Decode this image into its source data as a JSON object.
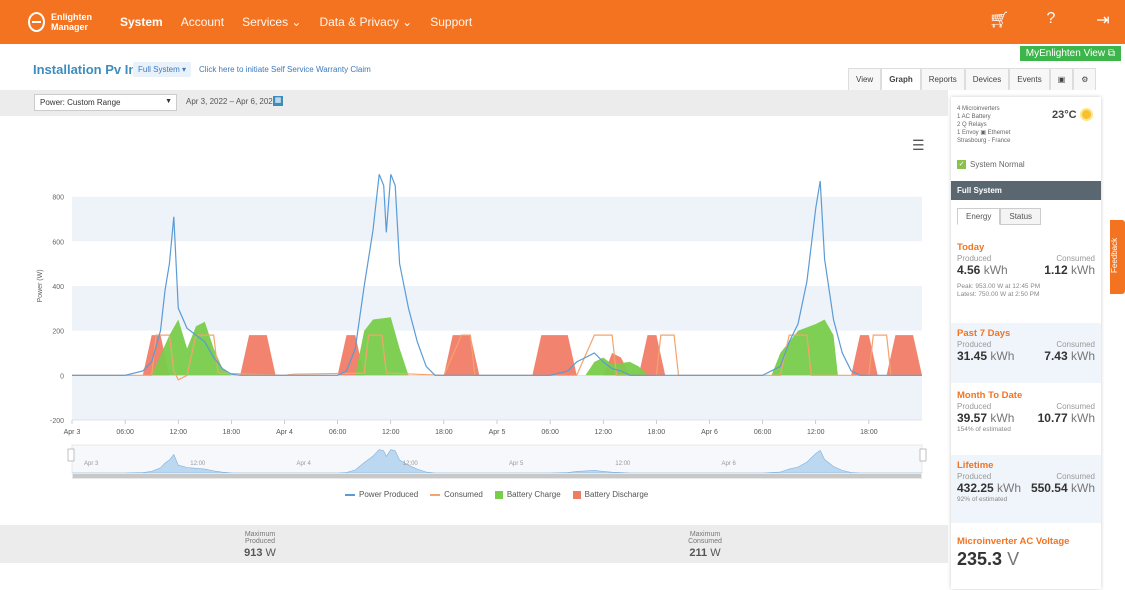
{
  "app": {
    "logo_line1": "Enlighten",
    "logo_line2": "Manager"
  },
  "nav": [
    "System",
    "Account",
    "Services ⌄",
    "Data & Privacy ⌄",
    "Support"
  ],
  "top_icons": [
    "cart-icon",
    "help-icon",
    "logout-icon"
  ],
  "myenlighten": "MyEnlighten View ⧉",
  "header": {
    "title": "Installation Pv Insa",
    "scope": "Full System ▾",
    "warranty_link": "Click here to initiate Self Service Warranty Claim"
  },
  "tabs": [
    "View",
    "Graph",
    "Reports",
    "Devices",
    "Events",
    "▣",
    "⚙"
  ],
  "controls": {
    "select_value": "Power: Custom Range",
    "date_range": "Apr 3, 2022 – Apr 6, 2022"
  },
  "chart_data": {
    "type": "line",
    "ylabel": "Power (W)",
    "ylim": [
      -200,
      1000
    ],
    "yticks": [
      -200,
      0,
      200,
      400,
      600,
      800
    ],
    "xticks": [
      "Apr 3",
      "06:00",
      "12:00",
      "18:00",
      "Apr 4",
      "06:00",
      "12:00",
      "18:00",
      "Apr 5",
      "06:00",
      "12:00",
      "18:00",
      "Apr 6",
      "06:00",
      "12:00",
      "18:00"
    ],
    "navigator_labels": [
      "Apr 3",
      "12:00",
      "Apr 4",
      "12:00",
      "Apr 5",
      "12:00",
      "Apr 6"
    ],
    "x_hours_start": 0,
    "series": [
      {
        "name": "Power Produced",
        "color": "#5b9bd5",
        "points": [
          [
            0,
            0
          ],
          [
            6,
            0
          ],
          [
            8,
            20
          ],
          [
            9,
            60
          ],
          [
            10,
            200
          ],
          [
            10.5,
            380
          ],
          [
            11,
            500
          ],
          [
            11.5,
            710
          ],
          [
            12,
            300
          ],
          [
            13,
            210
          ],
          [
            14,
            180
          ],
          [
            15,
            150
          ],
          [
            16,
            80
          ],
          [
            17,
            30
          ],
          [
            18,
            5
          ],
          [
            19,
            0
          ],
          [
            30,
            0
          ],
          [
            31,
            20
          ],
          [
            32,
            120
          ],
          [
            33,
            400
          ],
          [
            34,
            650
          ],
          [
            34.7,
            900
          ],
          [
            35.2,
            850
          ],
          [
            35.5,
            640
          ],
          [
            36,
            900
          ],
          [
            36.5,
            850
          ],
          [
            37,
            500
          ],
          [
            38,
            300
          ],
          [
            39,
            150
          ],
          [
            40,
            40
          ],
          [
            41,
            0
          ],
          [
            54,
            0
          ],
          [
            56,
            20
          ],
          [
            57,
            60
          ],
          [
            58,
            80
          ],
          [
            59,
            100
          ],
          [
            60,
            60
          ],
          [
            61,
            30
          ],
          [
            62,
            20
          ],
          [
            63,
            0
          ],
          [
            78,
            0
          ],
          [
            80,
            40
          ],
          [
            81,
            150
          ],
          [
            82,
            230
          ],
          [
            83,
            420
          ],
          [
            84,
            750
          ],
          [
            84.5,
            870
          ],
          [
            85,
            520
          ],
          [
            86,
            250
          ],
          [
            87,
            100
          ],
          [
            88,
            20
          ],
          [
            89,
            0
          ],
          [
            96,
            0
          ]
        ]
      },
      {
        "name": "Consumed",
        "color": "#f5a36c",
        "points": [
          [
            0,
            0
          ],
          [
            9,
            0
          ],
          [
            9.5,
            180
          ],
          [
            11,
            180
          ],
          [
            11.5,
            20
          ],
          [
            12,
            -20
          ],
          [
            13,
            0
          ],
          [
            14,
            180
          ],
          [
            16,
            180
          ],
          [
            16.5,
            10
          ],
          [
            24,
            0
          ],
          [
            25,
            5
          ],
          [
            33,
            10
          ],
          [
            33.5,
            180
          ],
          [
            35,
            180
          ],
          [
            35.5,
            10
          ],
          [
            42,
            0
          ],
          [
            44,
            180
          ],
          [
            45,
            180
          ],
          [
            45.5,
            0
          ],
          [
            57,
            0
          ],
          [
            59,
            180
          ],
          [
            61,
            180
          ],
          [
            61.5,
            0
          ],
          [
            66,
            0
          ],
          [
            66.5,
            180
          ],
          [
            68,
            180
          ],
          [
            68.5,
            0
          ],
          [
            80,
            0
          ],
          [
            81,
            180
          ],
          [
            83,
            180
          ],
          [
            83.5,
            0
          ],
          [
            90,
            0
          ],
          [
            90.5,
            180
          ],
          [
            92,
            180
          ],
          [
            92.5,
            0
          ],
          [
            96,
            0
          ]
        ]
      },
      {
        "name": "Battery Charge",
        "color": "#79cc4c",
        "points": [
          [
            9,
            0
          ],
          [
            11,
            180
          ],
          [
            12,
            250
          ],
          [
            13,
            120
          ],
          [
            14,
            220
          ],
          [
            15,
            240
          ],
          [
            16,
            120
          ],
          [
            17,
            30
          ],
          [
            18,
            0
          ],
          [
            32,
            0
          ],
          [
            33,
            200
          ],
          [
            34,
            250
          ],
          [
            36,
            260
          ],
          [
            37,
            120
          ],
          [
            38,
            0
          ],
          [
            58,
            0
          ],
          [
            59,
            60
          ],
          [
            60,
            80
          ],
          [
            61,
            50
          ],
          [
            63,
            60
          ],
          [
            64,
            40
          ],
          [
            65,
            0
          ],
          [
            79,
            0
          ],
          [
            80,
            100
          ],
          [
            82,
            200
          ],
          [
            84,
            230
          ],
          [
            85,
            250
          ],
          [
            86,
            180
          ],
          [
            86.5,
            0
          ]
        ]
      },
      {
        "name": "Battery Discharge",
        "color": "#f07c67",
        "points": [
          [
            8,
            0
          ],
          [
            9,
            180
          ],
          [
            10,
            180
          ],
          [
            11,
            0
          ],
          [
            19,
            0
          ],
          [
            20,
            180
          ],
          [
            22,
            180
          ],
          [
            23,
            0
          ],
          [
            30,
            0
          ],
          [
            31,
            180
          ],
          [
            32,
            180
          ],
          [
            33,
            0
          ],
          [
            42,
            0
          ],
          [
            43,
            180
          ],
          [
            45,
            180
          ],
          [
            46,
            0
          ],
          [
            52,
            0
          ],
          [
            53,
            180
          ],
          [
            56,
            180
          ],
          [
            57,
            0
          ],
          [
            60,
            0
          ],
          [
            61,
            100
          ],
          [
            62,
            80
          ],
          [
            63,
            0
          ],
          [
            64,
            0
          ],
          [
            65,
            180
          ],
          [
            66,
            180
          ],
          [
            67,
            0
          ],
          [
            88,
            0
          ],
          [
            89,
            180
          ],
          [
            90,
            180
          ],
          [
            91,
            0
          ],
          [
            92,
            0
          ],
          [
            93,
            180
          ],
          [
            95,
            180
          ],
          [
            96,
            0
          ]
        ]
      }
    ]
  },
  "stats": [
    {
      "label1": "Maximum",
      "label2": "Produced",
      "value": "913",
      "unit": "W"
    },
    {
      "label1": "Maximum",
      "label2": "Consumed",
      "value": "211",
      "unit": "W"
    }
  ],
  "panel": {
    "devices": [
      "4 Microinverters",
      "1 AC Battery",
      "2 Q Relays",
      "1 Envoy ▣ Ethernet",
      "Strasbourg - France"
    ],
    "temperature": "23°C",
    "status": "System Normal",
    "section_title": "Full System",
    "ptabs": [
      "Energy",
      "Status"
    ],
    "today": {
      "title": "Today",
      "produced_label": "Produced",
      "consumed_label": "Consumed",
      "produced": "4.56",
      "consumed": "1.12",
      "unit": "kWh",
      "peak": "Peak: 953.00 W at 12:45 PM",
      "latest": "Latest: 750.00 W at 2:50 PM"
    },
    "past7": {
      "title": "Past 7 Days",
      "produced_label": "Produced",
      "consumed_label": "Consumed",
      "produced": "31.45",
      "consumed": "7.43",
      "unit": "kWh"
    },
    "mtd": {
      "title": "Month To Date",
      "produced_label": "Produced",
      "consumed_label": "Consumed",
      "produced": "39.57",
      "consumed": "10.77",
      "unit": "kWh",
      "note": "154% of estimated"
    },
    "lifetime": {
      "title": "Lifetime",
      "produced_label": "Produced",
      "consumed_label": "Consumed",
      "produced": "432.25",
      "consumed": "550.54",
      "unit": "kWh",
      "note": "92% of estimated"
    },
    "voltage": {
      "title": "Microinverter AC Voltage",
      "value": "235.3",
      "unit": "V"
    }
  },
  "feedback": "Feedback"
}
